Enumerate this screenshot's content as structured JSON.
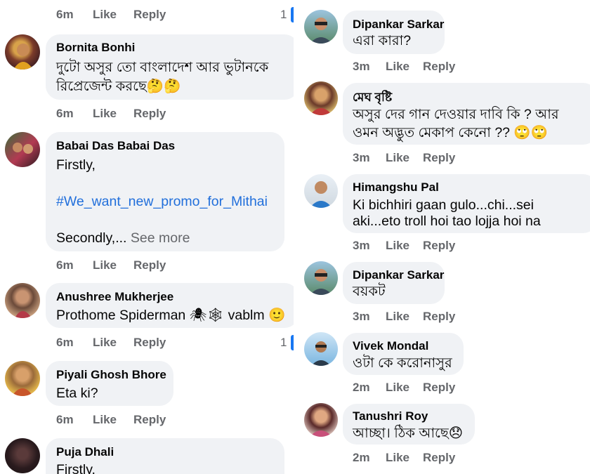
{
  "left": {
    "top_meta": {
      "time": "6m",
      "like": "Like",
      "reply": "Reply",
      "count": "1"
    },
    "comments": [
      {
        "name": "Bornita Bonhi",
        "lines": [
          "দুটো অসুর তো বাংলাদেশ আর ভুটানকে",
          "রিপ্রেজেন্ট করছে🤔🤔"
        ],
        "time": "6m",
        "like": "Like",
        "reply": "Reply"
      },
      {
        "name": "Babai Das Babai Das",
        "line1": "Firstly,",
        "hashtag": "#We_want_new_promo_for_Mithai",
        "line3": "Secondly,...",
        "see_more": "See more",
        "time": "6m",
        "like": "Like",
        "reply": "Reply"
      },
      {
        "name": "Anushree Mukherjee",
        "lines": [
          "Prothome Spiderman 🕷🕸 vablm 🙂"
        ],
        "time": "6m",
        "like": "Like",
        "reply": "Reply",
        "count": "1"
      },
      {
        "name": "Piyali Ghosh Bhore",
        "lines": [
          "Eta ki?"
        ],
        "time": "6m",
        "like": "Like",
        "reply": "Reply"
      },
      {
        "name": "Puja Dhali",
        "lines": [
          "Firstly,"
        ]
      }
    ]
  },
  "right": {
    "comments": [
      {
        "name": "Dipankar Sarkar",
        "lines": [
          "এরা কারা?"
        ],
        "time": "3m",
        "like": "Like",
        "reply": "Reply"
      },
      {
        "name": "মেঘ বৃষ্টি",
        "lines": [
          "অসুর দের গান দেওয়ার দাবি কি ? আর",
          "ওমন অদ্ভুত মেকাপ কেনো ?? 🙄🙄"
        ],
        "time": "3m",
        "like": "Like",
        "reply": "Reply"
      },
      {
        "name": "Himangshu Pal",
        "lines": [
          "Ki bichhiri gaan gulo...chi...sei",
          "aki...eto troll hoi tao lojja hoi na"
        ],
        "time": "3m",
        "like": "Like",
        "reply": "Reply"
      },
      {
        "name": "Dipankar Sarkar",
        "lines": [
          "বয়কট"
        ],
        "time": "3m",
        "like": "Like",
        "reply": "Reply"
      },
      {
        "name": "Vivek Mondal",
        "lines": [
          "ওটা কে করোনাসুর"
        ],
        "time": "2m",
        "like": "Like",
        "reply": "Reply"
      },
      {
        "name": "Tanushri Roy",
        "lines": [
          "আচ্ছা। ঠিক আছে😞"
        ],
        "time": "2m",
        "like": "Like",
        "reply": "Reply"
      }
    ]
  },
  "colors": {
    "bubble": "#f0f2f5",
    "link": "#216fdb",
    "meta": "#65676b",
    "accent": "#1877f2"
  }
}
